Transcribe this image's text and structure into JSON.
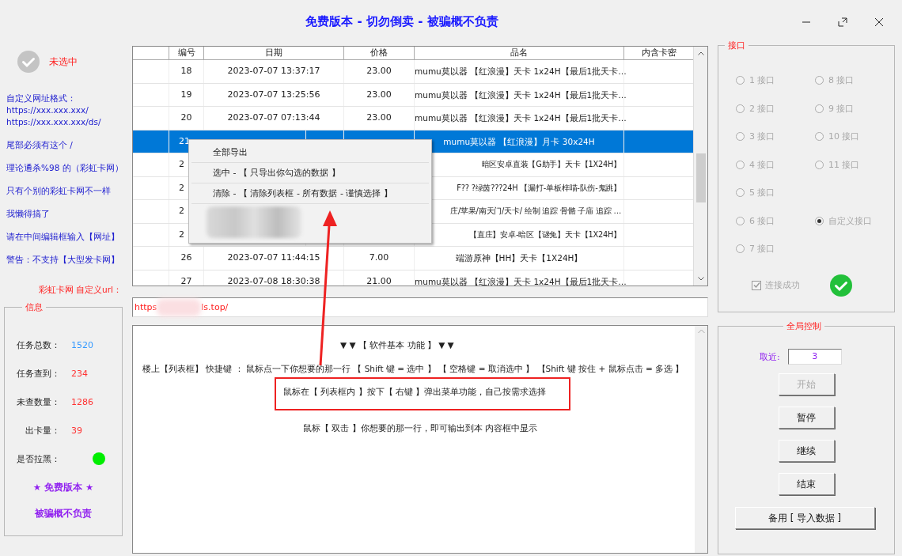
{
  "window": {
    "title": "免费版本 - 切勿倒卖 - 被骗概不负责"
  },
  "status": {
    "label": "未选中",
    "selected": false
  },
  "notes": [
    "自定义网址格式：\nhttps://xxx.xxx.xxx/\nhttps://xxx.xxx.xxx/ds/",
    "尾部必须有这个 /",
    "理论通杀%98 的（彩虹卡网）",
    "只有个别的彩虹卡网不一样",
    "我懒得搞了",
    "请在中间编辑框输入【网址】",
    "警告：不支持【大型发卡网】"
  ],
  "table": {
    "columns": [
      "编号",
      "日期",
      "价格",
      "品名",
      "内含卡密"
    ],
    "rows": [
      {
        "number": "18",
        "date": "2023-07-07 13:37:17",
        "price": "23.00",
        "product": "mumu莫以器 【红浪漫】天卡 1x24H【最后1批天卡…",
        "selected": false,
        "covered": false
      },
      {
        "number": "19",
        "date": "2023-07-07 13:25:56",
        "price": "23.00",
        "product": "mumu莫以器 【红浪漫】天卡 1x24H【最后1批天卡…",
        "selected": false,
        "covered": false
      },
      {
        "number": "20",
        "date": "2023-07-07 07:13:44",
        "price": "23.00",
        "product": "mumu莫以器 【红浪漫】天卡 1x24H【最后1批天卡…",
        "selected": false,
        "covered": false
      },
      {
        "number": "21",
        "product": "mumu莫以器 【红浪漫】月卡 30x24H",
        "selected": true,
        "covered": true
      },
      {
        "number": "2",
        "product": "暗区安卓直装【G助手】天卡【1X24H】",
        "selected": false,
        "covered": true
      },
      {
        "number": "2",
        "product": "F?? ?绿茵???24H 【漏打-单板梓喵-队伤-鬼跳】",
        "selected": false,
        "covered": true
      },
      {
        "number": "2",
        "product": "庄/苹果/南天门/天卡/ 绘制 追踪 骨骼 子庙 追踪 …",
        "selected": false,
        "covered": true
      },
      {
        "number": "2",
        "product": "【直庄】安卓-暗区【谜兔】天卡【1X24H】",
        "selected": false,
        "covered": true
      },
      {
        "number": "26",
        "date": "2023-07-07 11:44:15",
        "price": "7.00",
        "product": "端游原神【HH】天卡【1X24H】",
        "selected": false,
        "covered": false
      },
      {
        "number": "27",
        "date": "2023-07-08 18:30:38",
        "price": "21.00",
        "product": "mumu莫以器 【红浪漫】天卡 1x24H【最后1批天卡…",
        "selected": false,
        "covered": false
      }
    ]
  },
  "context_menu": {
    "items": [
      {
        "kind": "text",
        "label": "全部导出"
      },
      {
        "kind": "text",
        "label": "选中 - 【 只导出你勾选的数据 】"
      },
      {
        "kind": "text",
        "label": "清除 - 【 清除列表框 - 所有数据 - 谨慎选择 】"
      },
      {
        "kind": "blurred"
      }
    ]
  },
  "url": {
    "label": "彩虹卡网 自定义url：",
    "value_parts": [
      "https",
      "ls.top/"
    ]
  },
  "info": {
    "title": "信息",
    "stats": [
      {
        "label": "任务总数：",
        "value": "1520",
        "color": "#3399ff"
      },
      {
        "label": "任务查到：",
        "value": "234",
        "color": "#ff3333"
      },
      {
        "label": "未查数量：",
        "value": "1286",
        "color": "#ff3333"
      },
      {
        "label": "出卡量：",
        "value": "39",
        "color": "#ff3333"
      }
    ],
    "blacklist": {
      "label": "是否拉黑：",
      "color": "#00ee00"
    },
    "slogans": [
      "★ 免费版本 ★",
      "被骗概不负责"
    ]
  },
  "help": {
    "heading": "▼ ▼ 【 软件基本 功能 】 ▼ ▼",
    "lines": [
      "楼上【列表框】 快捷键 ： 鼠标点一下你想要的那一行 【 Shift 键 = 选中 】     【 空格键 = 取消选中 】    【Shift 键 按住 + 鼠标点击 = 多选 】",
      "鼠标在【 列表框内 】按下【 右键 】弹出菜单功能，自己按需求选择",
      "鼠标【 双击 】你想要的那一行，即可输出到本 内容框中显示"
    ]
  },
  "interfaces": {
    "title": "接口",
    "column_1": [
      {
        "label": "1  接口",
        "selected": false,
        "disabled": true
      },
      {
        "label": "2  接口",
        "selected": false,
        "disabled": true
      },
      {
        "label": "3  接口",
        "selected": false,
        "disabled": true
      },
      {
        "label": "4  接口",
        "selected": false,
        "disabled": true
      },
      {
        "label": "5  接口",
        "selected": false,
        "disabled": true
      },
      {
        "label": "6  接口",
        "selected": false,
        "disabled": true
      },
      {
        "label": "7  接口",
        "selected": false,
        "disabled": true
      }
    ],
    "column_2": [
      {
        "label": "8  接口",
        "selected": false,
        "disabled": true
      },
      {
        "label": "9  接口",
        "selected": false,
        "disabled": true
      },
      {
        "label": "10  接口",
        "selected": false,
        "disabled": true
      },
      {
        "label": "11  接口",
        "selected": false,
        "disabled": true
      },
      {
        "label": "自定义接口",
        "selected": true,
        "disabled": true
      }
    ],
    "connected": {
      "label": "连接成功",
      "checked": true,
      "disabled": true
    }
  },
  "control": {
    "title": "全局控制",
    "fetch_label": "取近:",
    "fetch_value": "3",
    "buttons": [
      {
        "label": "开始",
        "disabled": true,
        "kind": "small"
      },
      {
        "label": "暂停",
        "disabled": false,
        "kind": "small"
      },
      {
        "label": "继续",
        "disabled": false,
        "kind": "small"
      },
      {
        "label": "结束",
        "disabled": false,
        "kind": "small"
      },
      {
        "label": "备用 [ 导入数据 ]",
        "disabled": false,
        "kind": "wide"
      }
    ]
  }
}
